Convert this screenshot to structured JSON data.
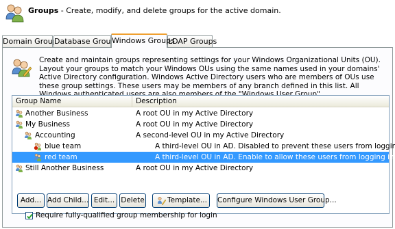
{
  "header": {
    "title": "Groups",
    "description": " - Create, modify, and delete groups for the active domain."
  },
  "tabs": [
    {
      "label": "Domain Groups",
      "active": false
    },
    {
      "label": "Database Groups",
      "active": false
    },
    {
      "label": "Windows Groups",
      "active": true
    },
    {
      "label": "LDAP Groups",
      "active": false
    }
  ],
  "intro": {
    "text": "Create and maintain groups representing settings for your Windows Organizational Units (OU). Layout your groups to match your Windows OUs using the same names used in your domains' Active Directory configuration. Windows Active Directory users who are members of OUs use these group settings. These users may be members of any branch defined in this list. All Windows authenticated users are also members of the \"Windows User Group\"."
  },
  "list": {
    "columns": [
      "Group Name",
      "Description"
    ],
    "rows": [
      {
        "name": "Another Business",
        "description": "A root OU in my Active Directory",
        "level": 0,
        "icon": "group-icon",
        "selected": false
      },
      {
        "name": "My Business",
        "description": "A root OU in my Active Directory",
        "level": 0,
        "icon": "group-icon",
        "selected": false
      },
      {
        "name": "Accounting",
        "description": "A second-level OU in my Active Directory",
        "level": 1,
        "icon": "group-icon",
        "selected": false
      },
      {
        "name": "blue team",
        "description": "A third-level OU in AD. Disabled to prevent these users from logging in.",
        "level": 2,
        "icon": "disabled-group-icon",
        "selected": false
      },
      {
        "name": "red team",
        "description": "A third-level OU in AD. Enable to allow these users from logging in.",
        "level": 2,
        "icon": "group-icon",
        "selected": true
      },
      {
        "name": "Still Another Business",
        "description": "A root OU in my Active Directory",
        "level": 0,
        "icon": "group-icon",
        "selected": false
      }
    ]
  },
  "buttons": {
    "add": "Add...",
    "add_child": "Add Child...",
    "edit": "Edit...",
    "delete": "Delete",
    "template": "Template...",
    "configure": "Configure Windows User Group..."
  },
  "checkbox": {
    "label": "Require fully-qualified group membership for login",
    "checked": true
  },
  "colors": {
    "selection": "#3399ff",
    "tab_accent": "#f0a030",
    "disabled_badge": "#cc2200"
  }
}
